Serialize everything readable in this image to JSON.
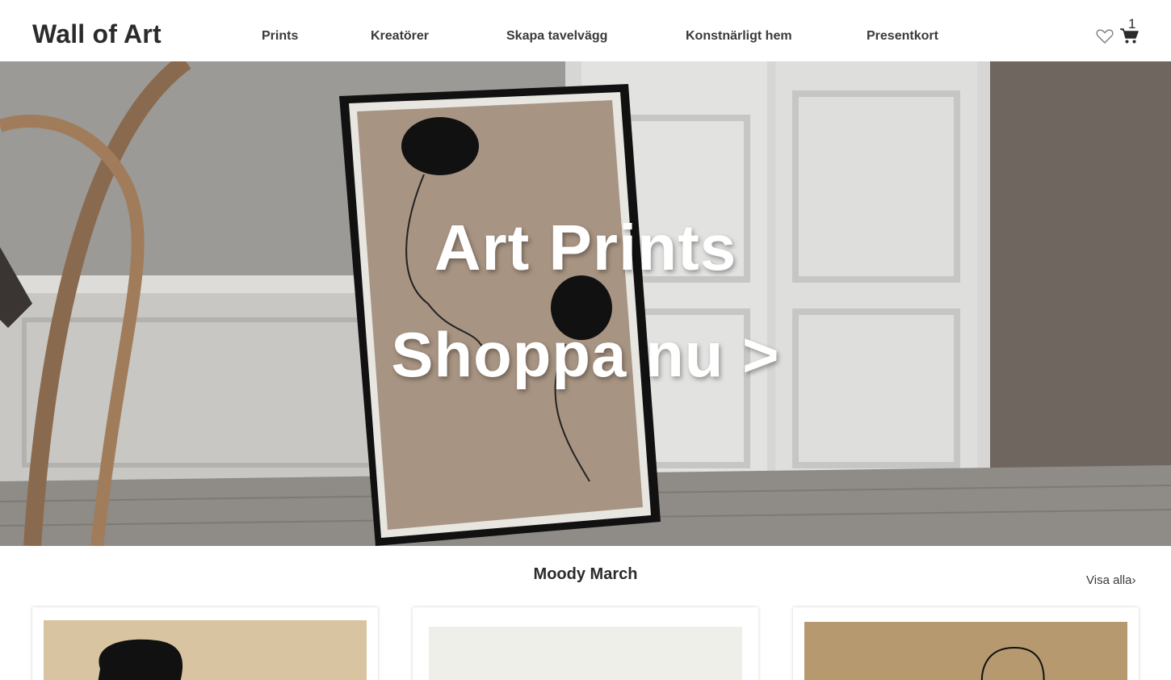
{
  "header": {
    "logo": "Wall of Art",
    "nav": [
      "Prints",
      "Kreatörer",
      "Skapa tavelvägg",
      "Konstnärligt hem",
      "Presentkort"
    ],
    "wishlist_icon": "heart-icon",
    "cart_icon": "cart-icon",
    "cart_count": "1"
  },
  "hero": {
    "title": "Art Prints",
    "cta": "Shoppa nu >"
  },
  "section": {
    "title": "Moody March",
    "view_all": "Visa alla"
  },
  "products": [
    {
      "name": "product-card-1",
      "bg_color": "#d9c4a1"
    },
    {
      "name": "product-card-2",
      "bg_color": "#efefea"
    },
    {
      "name": "product-card-3",
      "bg_color": "#b79970"
    }
  ]
}
